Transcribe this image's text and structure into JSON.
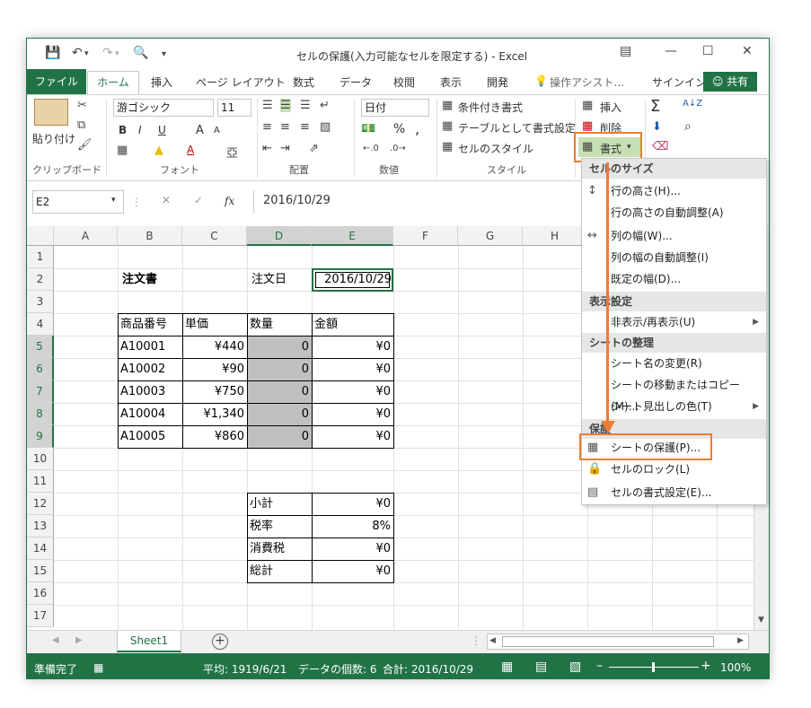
{
  "window": {
    "title": "セルの保護(入力可能なセルを限定する) - Excel"
  },
  "tabs": {
    "file": "ファイル",
    "home": "ホーム",
    "insert": "挿入",
    "page_layout": "ページ レイアウト",
    "formulas": "数式",
    "data": "データ",
    "review": "校閲",
    "view": "表示",
    "developer": "開発",
    "tell_me": "操作アシスト...",
    "signin": "サインイン",
    "share": "共有"
  },
  "ribbon": {
    "clipboard": {
      "paste": "貼り付け",
      "group": "クリップボード"
    },
    "font": {
      "name": "游ゴシック",
      "size": "11",
      "bold": "B",
      "italic": "I",
      "underline": "U",
      "grow": "A",
      "shrink": "A",
      "font_color": "A",
      "group": "フォント"
    },
    "alignment": {
      "group": "配置"
    },
    "number": {
      "format": "日付",
      "percent": "%",
      "comma": ",",
      "group": "数値"
    },
    "styles": {
      "conditional": "条件付き書式",
      "table": "テーブルとして書式設定",
      "cell_styles": "セルのスタイル",
      "group": "スタイル"
    },
    "cells": {
      "insert": "挿入",
      "delete": "削除",
      "format": "書式"
    },
    "editing": {
      "sum": "Σ",
      "sort": "A↓Z",
      "find": "⌕"
    }
  },
  "formula_bar": {
    "name_box": "E2",
    "fx": "fx",
    "value": "2016/10/29"
  },
  "columns": [
    "A",
    "B",
    "C",
    "D",
    "E",
    "F",
    "G",
    "H"
  ],
  "rows": [
    "1",
    "2",
    "3",
    "4",
    "5",
    "6",
    "7",
    "8",
    "9",
    "10",
    "11",
    "12",
    "13",
    "14",
    "15",
    "16",
    "17"
  ],
  "cells": {
    "b2": "注文書",
    "d2": "注文日",
    "e2": "2016/10/29",
    "b4": "商品番号",
    "c4": "単価",
    "d4": "数量",
    "e4": "金額",
    "items": [
      {
        "code": "A10001",
        "price": "¥440",
        "qty": "0",
        "amount": "¥0"
      },
      {
        "code": "A10002",
        "price": "¥90",
        "qty": "0",
        "amount": "¥0"
      },
      {
        "code": "A10003",
        "price": "¥750",
        "qty": "0",
        "amount": "¥0"
      },
      {
        "code": "A10004",
        "price": "¥1,340",
        "qty": "0",
        "amount": "¥0"
      },
      {
        "code": "A10005",
        "price": "¥860",
        "qty": "0",
        "amount": "¥0"
      }
    ],
    "summary": [
      {
        "label": "小計",
        "value": "¥0"
      },
      {
        "label": "税率",
        "value": "8%"
      },
      {
        "label": "消費税",
        "value": "¥0"
      },
      {
        "label": "総計",
        "value": "¥0"
      }
    ]
  },
  "sheet_tabs": {
    "active": "Sheet1",
    "add": "+"
  },
  "status": {
    "ready": "準備完了",
    "average": "平均: 1919/6/21",
    "count": "データの個数: 6",
    "sum": "合計: 2016/10/29",
    "zoom": "100%"
  },
  "format_menu": {
    "cell_size_header": "セルのサイズ",
    "row_height": "行の高さ(H)...",
    "autofit_row": "行の高さの自動調整(A)",
    "col_width": "列の幅(W)...",
    "autofit_col": "列の幅の自動調整(I)",
    "default_width": "既定の幅(D)...",
    "visibility_header": "表示設定",
    "hide_unhide": "非表示/再表示(U)",
    "organize_header": "シートの整理",
    "rename": "シート名の変更(R)",
    "move_copy": "シートの移動またはコピー(M)...",
    "tab_color": "シート見出しの色(T)",
    "protection_header": "保護",
    "protect_sheet": "シートの保護(P)...",
    "lock_cell": "セルのロック(L)",
    "format_cells": "セルの書式設定(E)..."
  },
  "colors": {
    "accent": "#217346",
    "highlight": "#ed7d31",
    "input_fill": "#c0c0c0"
  }
}
